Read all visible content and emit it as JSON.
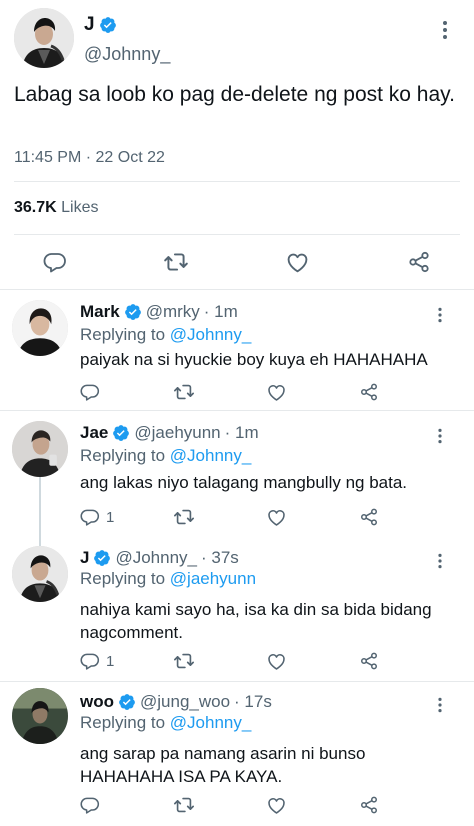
{
  "main_tweet": {
    "name": "J",
    "handle": "@Johnny_",
    "text": "Labag sa loob ko pag de-delete ng post ko hay.",
    "timestamp": "11:45 PM · 22 Oct 22",
    "likes_count": "36.7K",
    "likes_label": " Likes",
    "verified": true
  },
  "replies": [
    {
      "name": "Mark",
      "handle": "@mrky",
      "time": "· 1m",
      "replying_label": "Replying to ",
      "replying_to": "@Johnny_",
      "text": "paiyak na si hyuckie boy kuya eh HAHAHAHA",
      "reply_count": ""
    },
    {
      "name": "Jae",
      "handle": "@jaehyunn",
      "time": "· 1m",
      "replying_label": "Replying to ",
      "replying_to": "@Johnny_",
      "text": "ang lakas niyo talagang mangbully ng bata.",
      "reply_count": "1"
    },
    {
      "name": "J",
      "handle": "@Johnny_",
      "time": "· 37s",
      "replying_label": "Replying to ",
      "replying_to": "@jaehyunn",
      "text": "nahiya kami sayo ha, isa ka din sa bida bidang nagcomment.",
      "reply_count": "1"
    },
    {
      "name": "woo",
      "handle": "@jung_woo",
      "time": "· 17s",
      "replying_label": "Replying to ",
      "replying_to": "@Johnny_",
      "text": "ang sarap pa namang asarin ni bunso HAHAHAHA ISA PA KAYA.",
      "reply_count": ""
    }
  ],
  "icons": {
    "reply": "reply-icon",
    "retweet": "retweet-icon",
    "like": "heart-icon",
    "share": "share-icon",
    "more": "more-icon",
    "verified": "verified-badge-icon"
  },
  "colors": {
    "accent": "#1d9bf0",
    "text": "#0f1419",
    "secondary": "#536471",
    "divider": "#e6e9eb"
  }
}
